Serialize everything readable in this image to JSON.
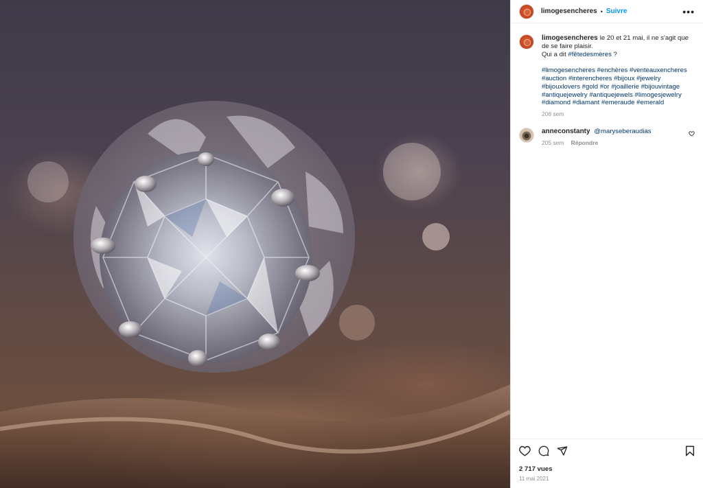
{
  "post": {
    "author": "limogesencheres",
    "follow_label": "Suivre",
    "dot": "•",
    "more_label": "•••",
    "caption": {
      "line1": "le 20 et 21 mai, il ne s'agit que de se faire plaisir.",
      "line2_prefix": "Qui a dit ",
      "line2_tag": "#fêtedesmères",
      "line2_suffix": " ?",
      "hashtags": [
        "#limogesencheres",
        "#enchères",
        "#venteauxencheres",
        "#auction",
        "#interencheres",
        "#bijoux",
        "#jewelry",
        "#bijouxlovers",
        "#gold",
        "#or",
        "#joaillerie",
        "#bijouvintage",
        "#antiquejewelry",
        "#antiquejewels",
        "#limogesjewelry",
        "#diamond",
        "#diamant",
        "#emeraude",
        "#emerald"
      ],
      "time": "206 sem"
    },
    "comment": {
      "user": "anneconstanty",
      "mention": "@maryseberaudias",
      "time": "205 sem",
      "reply_label": "Répondre"
    },
    "views": "2 717 vues",
    "date": "11 mai 2021"
  },
  "icons": {
    "like": "heart-icon",
    "comment": "comment-bubble-icon",
    "share": "paper-plane-icon",
    "save": "bookmark-icon",
    "more": "more-options-icon"
  },
  "colors": {
    "link": "#0095f6",
    "hashtag": "#00376b",
    "muted": "#8e8e8e",
    "text": "#262626",
    "avatar": "#c94a22"
  }
}
